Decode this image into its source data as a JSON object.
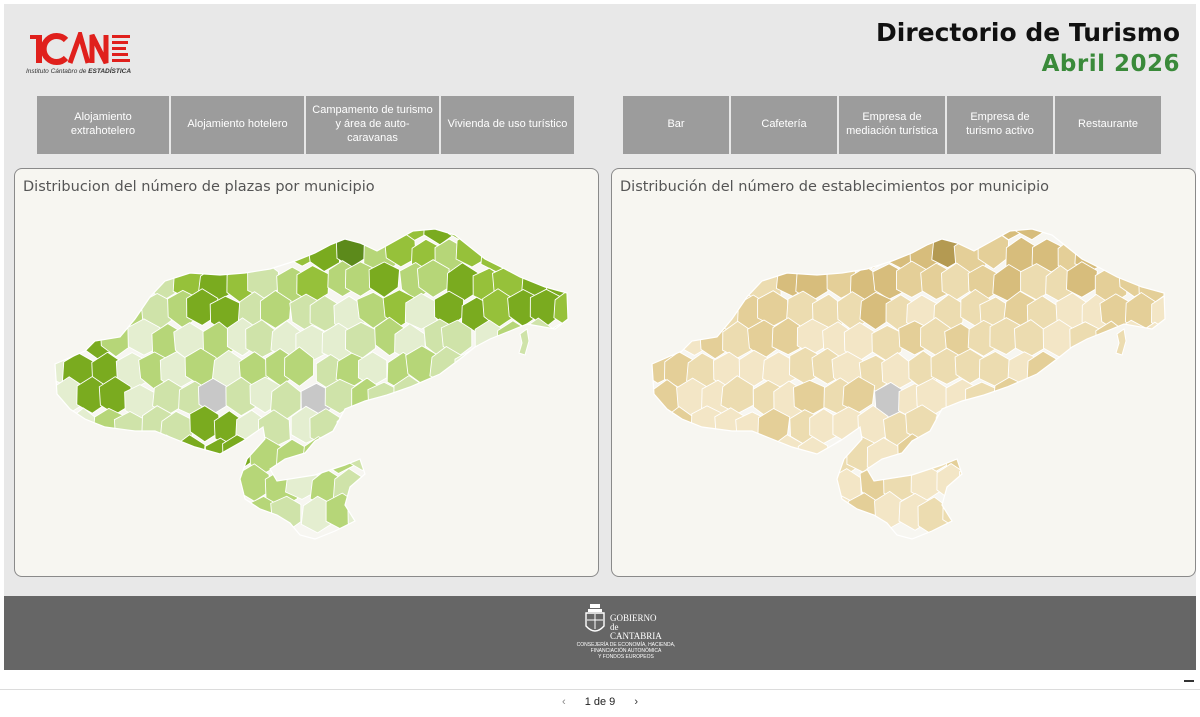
{
  "header": {
    "logo_text": "ICANE",
    "logo_subtitle_prefix": "Instituto Cántabro de ",
    "logo_subtitle_bold": "ESTADÍSTICA",
    "title": "Directorio de Turismo",
    "subtitle": "Abril 2026"
  },
  "tabs_left": [
    {
      "label": "Alojamiento extrahotelero"
    },
    {
      "label": "Alojamiento hotelero"
    },
    {
      "label": "Campamento de turismo y área de auto-caravanas"
    },
    {
      "label": "Vivienda de uso turístico"
    }
  ],
  "tabs_right": [
    {
      "label": "Bar"
    },
    {
      "label": "Cafetería"
    },
    {
      "label": "Empresa de mediación turística"
    },
    {
      "label": "Empresa de turismo activo"
    },
    {
      "label": "Restaurante"
    }
  ],
  "panels": {
    "left_title": "Distribucion del número de plazas por municipio",
    "right_title": "Distribución del número de establecimientos por municipio"
  },
  "colors": {
    "green_palette": [
      "#e4eed0",
      "#cfe3a9",
      "#b6d678",
      "#96c13a",
      "#7aab1f",
      "#5c8a1b"
    ],
    "tan_palette": [
      "#f3e6c6",
      "#ecdcb0",
      "#e4cf98",
      "#d7bd7c",
      "#b49a52"
    ],
    "nodata": "#c8c8c8",
    "title_green": "#3a8a3a"
  },
  "footer": {
    "gov_line1": "GOBIERNO",
    "gov_line2": "de",
    "gov_line3": "CANTABRIA",
    "consejeria": [
      "CONSEJERÍA DE ECONOMÍA, HACIENDA,",
      "FINANCIACIÓN AUTONÓMICA",
      "Y FONDOS EUROPEOS"
    ]
  },
  "pager": {
    "current_label": "1 de 9",
    "prev_icon": "chevron-left-icon",
    "next_icon": "chevron-right-icon"
  }
}
